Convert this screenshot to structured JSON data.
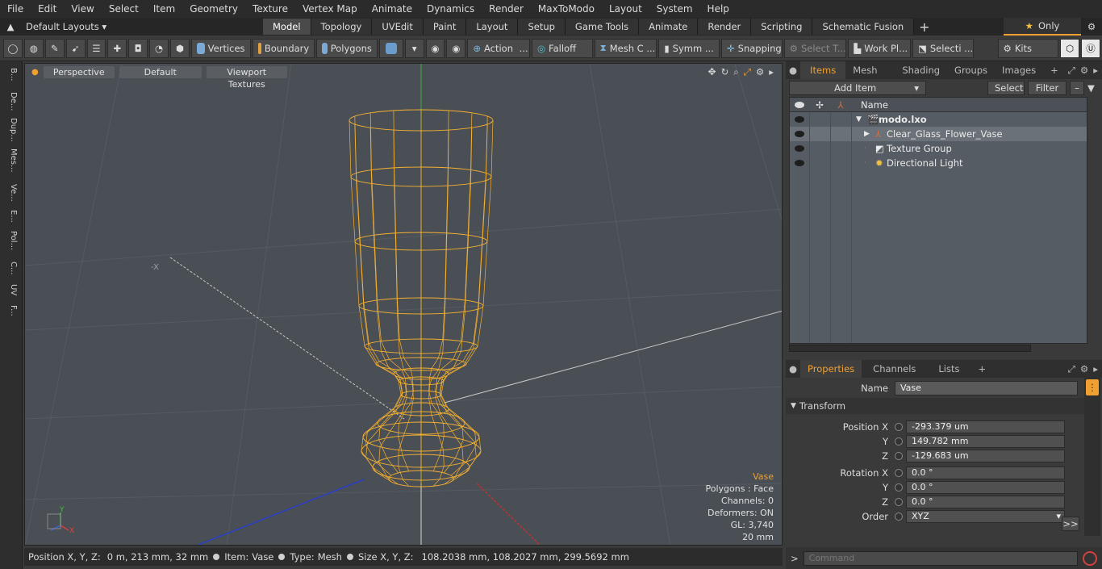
{
  "menu": [
    "File",
    "Edit",
    "View",
    "Select",
    "Item",
    "Geometry",
    "Texture",
    "Vertex Map",
    "Animate",
    "Dynamics",
    "Render",
    "MaxToModo",
    "Layout",
    "System",
    "Help"
  ],
  "layout": {
    "preset": "Default Layouts ▾",
    "tabs": [
      "Model",
      "Topology",
      "UVEdit",
      "Paint",
      "Layout",
      "Setup",
      "Game Tools",
      "Animate",
      "Render",
      "Scripting",
      "Schematic Fusion"
    ],
    "active_tab": "Model",
    "only": "Only"
  },
  "toolbar": {
    "vertices": "Vertices",
    "boundary": "Boundary",
    "polygons": "Polygons",
    "action": "Action",
    "falloff": "Falloff",
    "mesh": "Mesh C ...",
    "symm": "Symm ...",
    "snapping": "Snapping",
    "select_t": "Select T...",
    "work_plane": "Work Pl...",
    "selecti": "Selecti ...",
    "kits": "Kits"
  },
  "left_tabs": [
    "B...",
    "De...",
    "Dup...",
    "Mes...",
    "Ve...",
    "E...",
    "Pol...",
    "C...",
    "UV",
    "F..."
  ],
  "viewport": {
    "view": "Perspective",
    "shading": "Default",
    "textures": "Viewport Textures",
    "neg_x_label": "-X",
    "axis_y": "Y",
    "axis_x": "X"
  },
  "hud": {
    "item": "Vase",
    "polygons": "Polygons : Face",
    "channels": "Channels: 0",
    "deformers": "Deformers: ON",
    "gl": "GL: 3,740",
    "scale": "20 mm"
  },
  "status": {
    "pos_label": "Position X, Y, Z:",
    "pos_val": "0 m, 213 mm, 32 mm",
    "item_label": "Item:",
    "item_val": "Vase",
    "type_label": "Type:",
    "type_val": "Mesh",
    "size_label": "Size X, Y, Z:",
    "size_val": "108.2038 mm, 108.2027 mm, 299.5692 mm"
  },
  "items_panel": {
    "tabs": [
      "Items",
      "Mesh Ops",
      "Shading",
      "Groups",
      "Images"
    ],
    "add_item": "Add Item",
    "select": "Select",
    "filter": "Filter",
    "col_name": "Name",
    "tree": [
      {
        "label": "modo.lxo",
        "bold": true
      },
      {
        "label": "Clear_Glass_Flower_Vase"
      },
      {
        "label": "Texture Group"
      },
      {
        "label": "Directional Light"
      }
    ]
  },
  "props_panel": {
    "tabs": [
      "Properties",
      "Channels",
      "Lists"
    ],
    "name_label": "Name",
    "name_value": "Vase",
    "section": "Transform",
    "position_label": "Position X",
    "pos_x": "-293.379 um",
    "pos_y": "149.782 mm",
    "pos_z": "-129.683 um",
    "rotation_label": "Rotation X",
    "rot_x": "0.0 °",
    "rot_y": "0.0 °",
    "rot_z": "0.0 °",
    "order_label": "Order",
    "order_value": "XYZ",
    "y": "Y",
    "z": "Z",
    "more": ">>"
  },
  "command": {
    "placeholder": "Command"
  },
  "colors": {
    "accent": "#f0a030",
    "wire": "#f5b030"
  }
}
